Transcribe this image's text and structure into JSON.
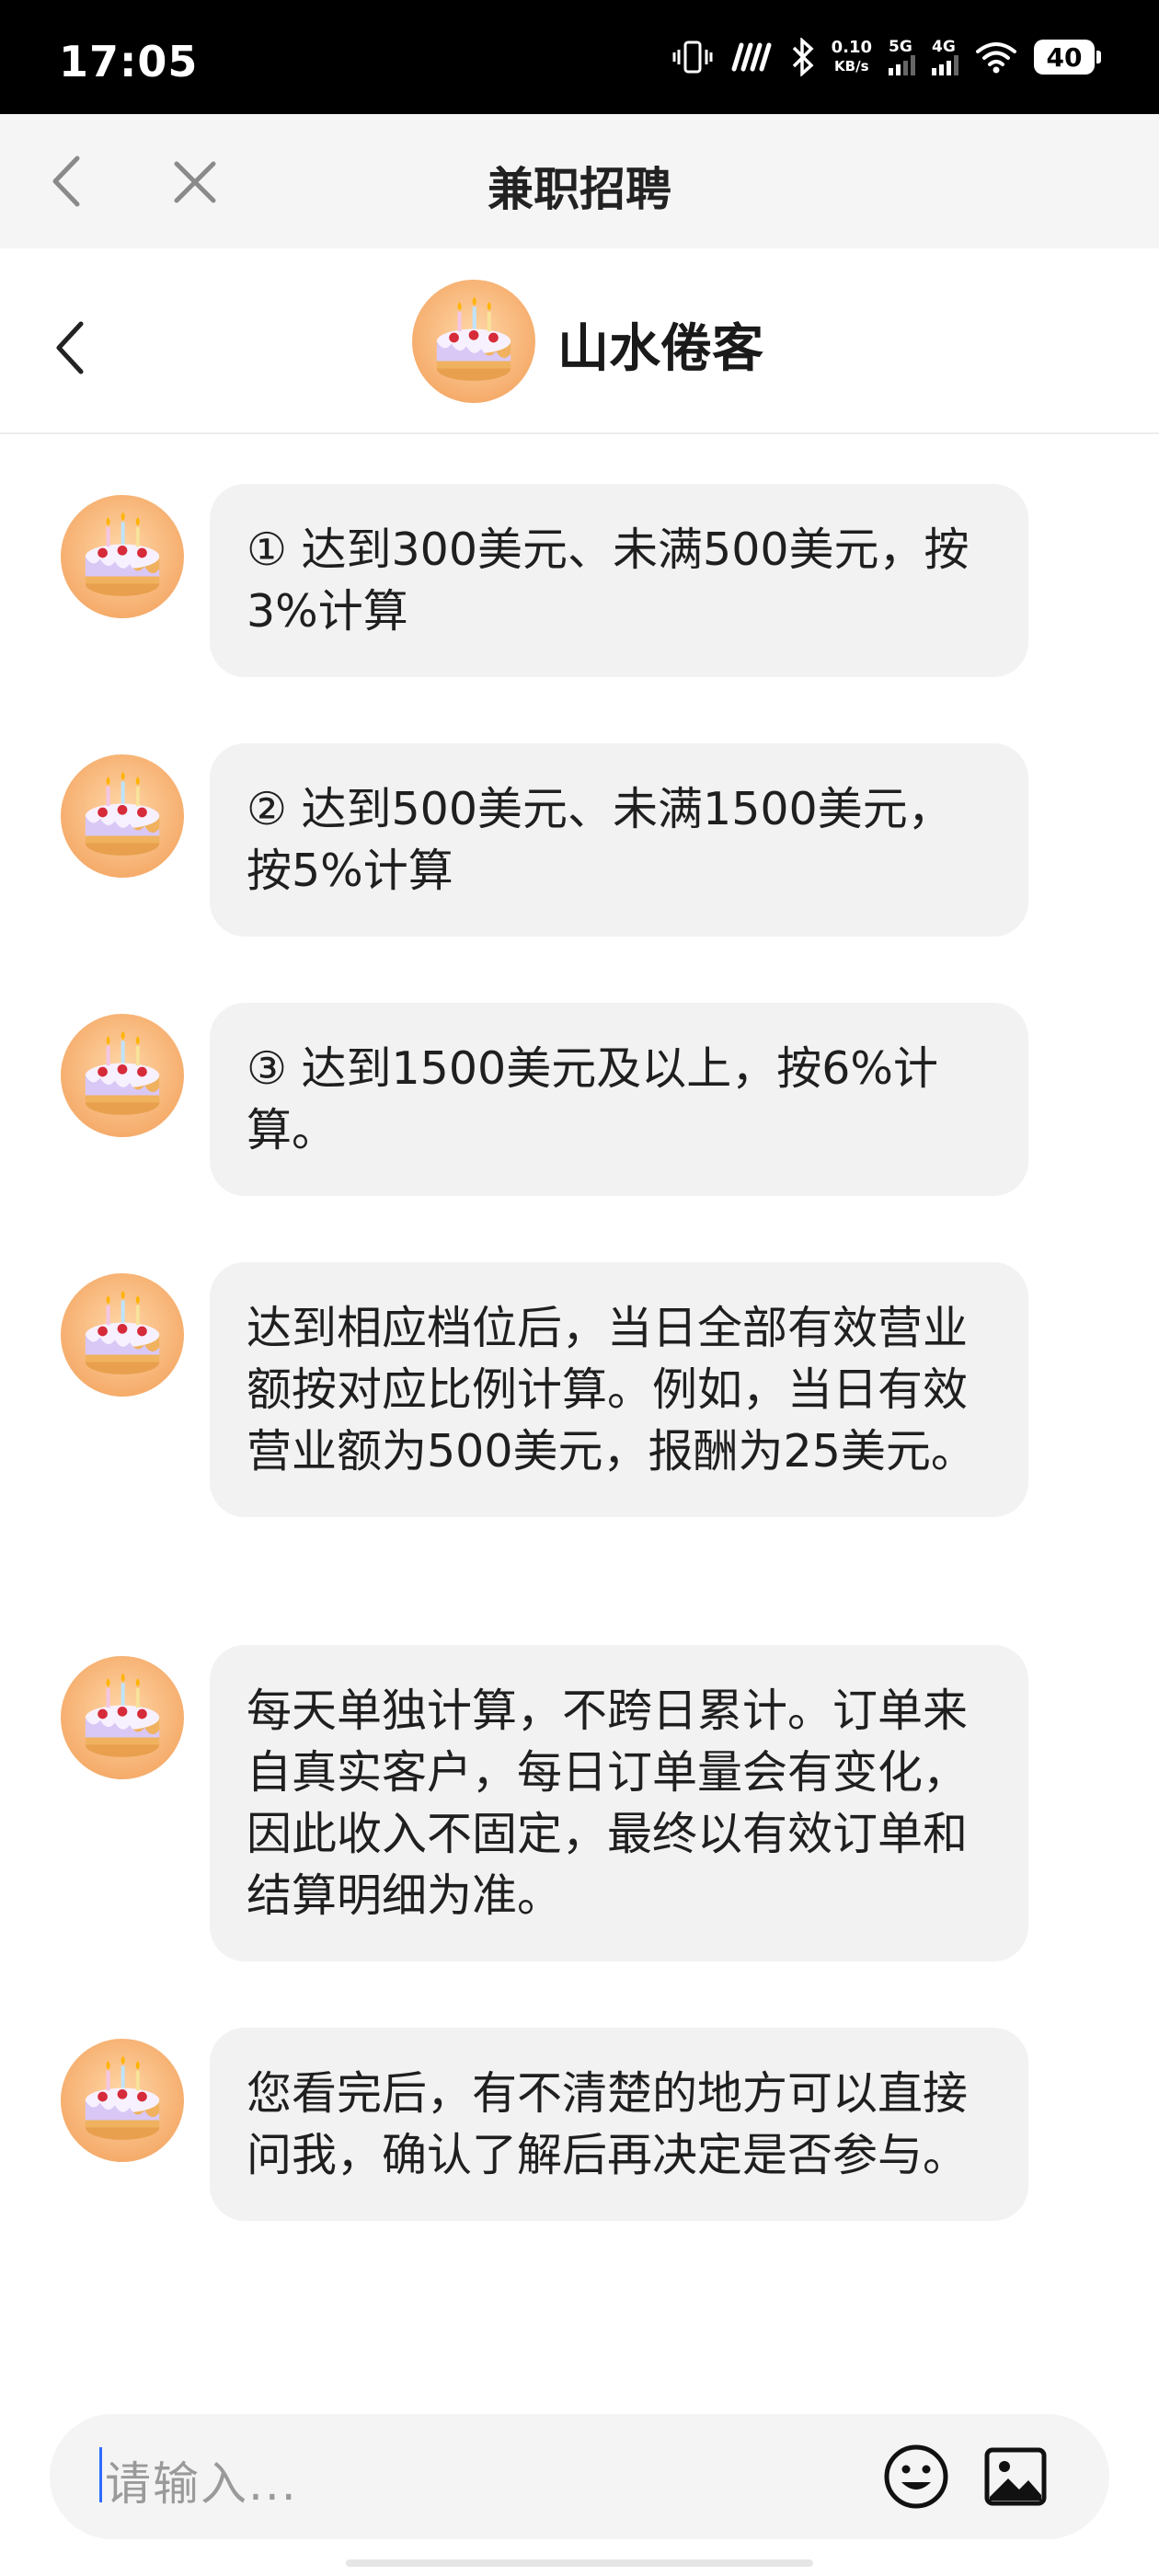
{
  "status_bar": {
    "time": "17:05",
    "net_speed_value": "0.10",
    "net_speed_unit": "KB/s",
    "signal_1_label": "5G",
    "signal_2_label": "4G",
    "battery": "40",
    "icons": [
      "vibrate-icon",
      "nfc-icon",
      "bluetooth-icon",
      "signal-5g-icon",
      "signal-4g-icon",
      "wifi-icon",
      "battery-icon"
    ]
  },
  "web_header": {
    "title": "兼职招聘",
    "back_icon": "chevron-left-icon",
    "close_icon": "close-icon"
  },
  "chat_header": {
    "name": "山水倦客",
    "back_icon": "chevron-left-icon",
    "avatar_icon": "birthday-cake-icon"
  },
  "messages": [
    {
      "text": "① 达到300美元、未满500美元，按3%计算"
    },
    {
      "text": "② 达到500美元、未满1500美元，按5%计算"
    },
    {
      "text": "③ 达到1500美元及以上，按6%计算。"
    },
    {
      "text": "达到相应档位后，当日全部有效营业额按对应比例计算。例如，当日有效营业额为500美元，报酬为25美元。"
    },
    {
      "text": "每天单独计算，不跨日累计。订单来自真实客户，每日订单量会有变化，因此收入不固定，最终以有效订单和结算明细为准。"
    },
    {
      "text": "您看完后，有不清楚的地方可以直接问我，确认了解后再决定是否参与。"
    }
  ],
  "input": {
    "placeholder": "请输入...",
    "emoji_icon": "smiley-icon",
    "image_icon": "image-icon"
  },
  "colors": {
    "status_bar_bg": "#000000",
    "web_header_bg": "#f5f5f5",
    "bubble_bg": "#f2f2f2",
    "avatar_bg": "#f7b77a",
    "caret": "#2f6bff"
  }
}
